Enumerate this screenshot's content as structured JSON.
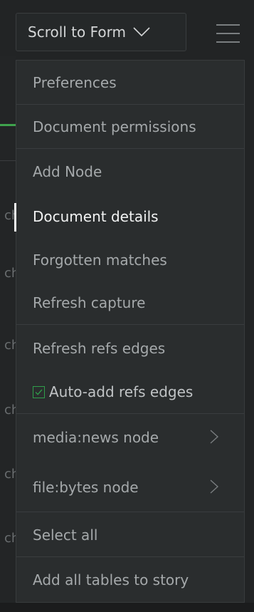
{
  "topbar": {
    "scroll_button_label": "Scroll to Form",
    "scroll_chevron_icon": "chevron-down-icon",
    "menu_icon": "hamburger-icon"
  },
  "colors": {
    "accent_green": "#3fa34d",
    "menu_background": "#2a2d2e",
    "text_muted": "#a5a9ab",
    "text_active": "#f2f3f3"
  },
  "menu": {
    "items": [
      {
        "label": "Preferences"
      },
      {
        "label": "Document permissions"
      },
      {
        "label": "Add Node"
      },
      {
        "label": "Document details",
        "active": true
      },
      {
        "label": "Forgotten matches"
      },
      {
        "label": "Refresh capture"
      },
      {
        "label": "Refresh refs edges"
      },
      {
        "label": "Auto-add refs edges",
        "checked": true
      },
      {
        "label": "media:news node",
        "submenu": true
      },
      {
        "label": "file:bytes node",
        "submenu": true
      },
      {
        "label": "Select all"
      },
      {
        "label": "Add all tables to story"
      }
    ]
  }
}
